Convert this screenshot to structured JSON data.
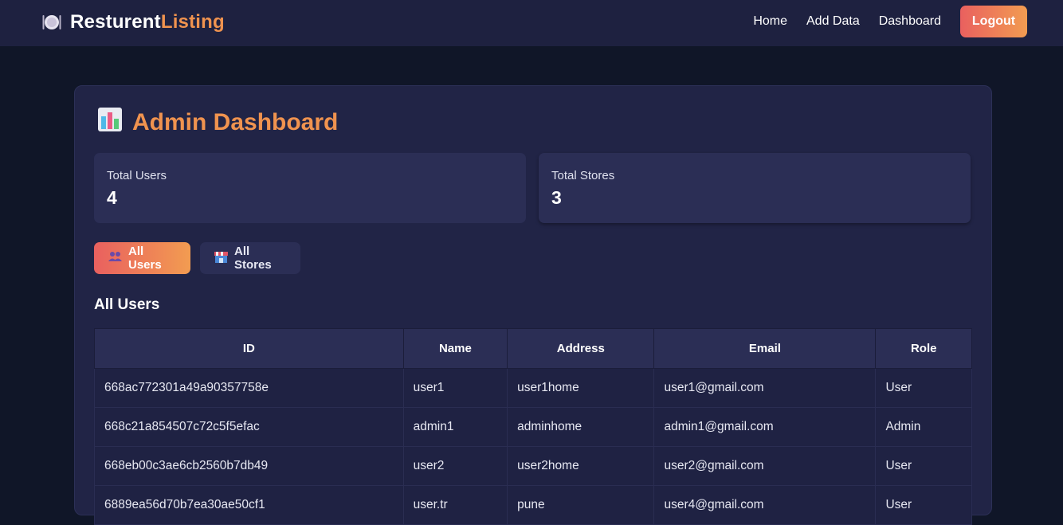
{
  "brand": {
    "main": "Resturent",
    "accent": "Listing",
    "icon": "plate-cutlery-icon"
  },
  "nav": {
    "home": "Home",
    "add_data": "Add Data",
    "dashboard": "Dashboard",
    "logout": "Logout"
  },
  "dashboard": {
    "title_icon": "bar-chart-icon",
    "title": "Admin Dashboard",
    "stats": {
      "users_label": "Total Users",
      "users_value": "4",
      "stores_label": "Total Stores",
      "stores_value": "3"
    },
    "tabs": {
      "users": "All Users",
      "stores": "All Stores",
      "users_icon": "people-icon",
      "stores_icon": "store-icon",
      "active": "users"
    },
    "section_title": "All Users",
    "table": {
      "headers": [
        "ID",
        "Name",
        "Address",
        "Email",
        "Role"
      ],
      "rows": [
        [
          "668ac772301a49a90357758e",
          "user1",
          "user1home",
          "user1@gmail.com",
          "User"
        ],
        [
          "668c21a854507c72c5f5efac",
          "admin1",
          "adminhome",
          "admin1@gmail.com",
          "Admin"
        ],
        [
          "668eb00c3ae6cb2560b7db49",
          "user2",
          "user2home",
          "user2@gmail.com",
          "User"
        ],
        [
          "6889ea56d70b7ea30ae50cf1",
          "user.tr",
          "pune",
          "user4@gmail.com",
          "User"
        ]
      ]
    }
  },
  "colors": {
    "background": "#101628",
    "navbar": "#1e2140",
    "card": "#212446",
    "accent_orange": "#f0934f",
    "gradient_start": "#e9605f",
    "gradient_end": "#f29c51"
  }
}
